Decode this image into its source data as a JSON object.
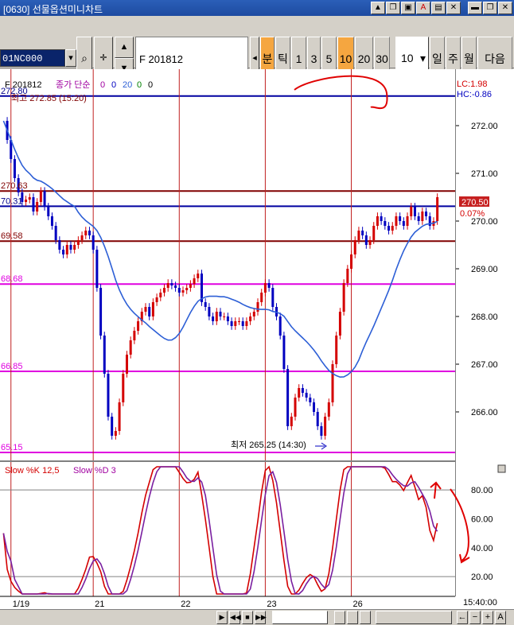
{
  "window": {
    "title": "[0630] 선물옵션미니차트",
    "buttons": [
      "▲",
      "❐",
      "▣",
      "A",
      "▤",
      "✕"
    ],
    "tail_buttons": [
      "▬",
      "❐",
      "✕"
    ]
  },
  "toolbar": {
    "code_value": "01NC000",
    "name_value": "F 201812",
    "periods": [
      "분",
      "틱",
      "1",
      "3",
      "5",
      "10",
      "20",
      "30"
    ],
    "active_period": "10",
    "count_value": "10",
    "units": [
      "일",
      "주",
      "월"
    ],
    "next_label": "다음"
  },
  "legend": {
    "instrument": "F 201812",
    "indicator": "종가 단순",
    "params": [
      "0",
      "0",
      "20",
      "0",
      "0"
    ],
    "high_text": "최고 272.85 (15:20)",
    "low_text": "최저 265.25 (14:30)",
    "lc": "LC:1.98",
    "hc": "HC:-0.86",
    "current_price": "270.50",
    "change_pct": "0.07%"
  },
  "price_axis": {
    "ticks": [
      "272.00",
      "271.00",
      "270.00",
      "269.00",
      "268.00",
      "267.00",
      "266.00"
    ],
    "tick_values": [
      272,
      271,
      270,
      269,
      268,
      267,
      266
    ],
    "range": [
      265.05,
      272.85
    ]
  },
  "level_labels": [
    {
      "text": "272.80",
      "value": 272.62,
      "color": "#00008b"
    },
    {
      "text": "270.63",
      "value": 270.63,
      "color": "#800000"
    },
    {
      "text": "70.31",
      "value": 270.31,
      "color": "#00008b"
    },
    {
      "text": "69.58",
      "value": 269.58,
      "color": "#800000"
    },
    {
      "text": "68.68",
      "value": 268.68,
      "color": "#e000e0"
    },
    {
      "text": "66.85",
      "value": 266.85,
      "color": "#e000e0"
    },
    {
      "text": "65.15",
      "value": 265.15,
      "color": "#e000e0"
    }
  ],
  "stoch": {
    "title": "Slow %K 12,5",
    "title2": "Slow %D 3",
    "ticks": [
      "80.00",
      "60.00",
      "40.00",
      "20.00"
    ],
    "tick_values": [
      80,
      60,
      40,
      20
    ]
  },
  "time_axis": {
    "labels": [
      "1/19",
      "21",
      "22",
      "23",
      "26"
    ],
    "clock": "15:40:00"
  },
  "colors": {
    "up": "#d40000",
    "down": "#0000c0",
    "ma": "#2d5fd6",
    "day_sep": "#c02020",
    "active": "#f5a640"
  },
  "chart_data": {
    "type": "candlestick",
    "title": "F 201812",
    "xlabel": "",
    "ylabel": "",
    "ylim": [
      265.05,
      272.85
    ],
    "days": [
      "1/19",
      "21",
      "22",
      "23",
      "26"
    ],
    "closes": [
      272.1,
      271.7,
      271.3,
      270.9,
      270.6,
      270.4,
      270.45,
      270.5,
      270.2,
      270.4,
      270.63,
      270.3,
      270.1,
      269.9,
      269.6,
      269.4,
      269.3,
      269.5,
      269.4,
      269.5,
      269.6,
      269.7,
      269.8,
      269.7,
      269.4,
      268.6,
      267.6,
      266.8,
      265.9,
      265.5,
      265.6,
      266.2,
      266.8,
      267.2,
      267.5,
      267.7,
      267.9,
      268.1,
      268.2,
      268.0,
      268.3,
      268.4,
      268.5,
      268.6,
      268.7,
      268.65,
      268.6,
      268.5,
      268.55,
      268.6,
      268.68,
      268.8,
      268.9,
      268.3,
      268.2,
      268.0,
      267.9,
      268.1,
      268.0,
      268.0,
      267.9,
      267.8,
      267.9,
      267.9,
      267.8,
      267.9,
      268.0,
      268.1,
      268.3,
      268.5,
      268.7,
      268.6,
      268.2,
      268.0,
      267.6,
      266.9,
      265.7,
      265.9,
      266.3,
      266.5,
      266.4,
      266.3,
      266.2,
      266.0,
      265.7,
      265.5,
      265.9,
      266.2,
      267.0,
      267.6,
      268.1,
      268.7,
      269.0,
      269.3,
      269.6,
      269.8,
      269.7,
      269.5,
      269.6,
      269.9,
      270.1,
      270.0,
      269.9,
      269.8,
      269.9,
      270.1,
      270.0,
      269.9,
      270.1,
      270.3,
      270.1,
      270.0,
      270.2,
      270.1,
      269.9,
      270.0,
      270.5
    ],
    "ma_window": 20,
    "levels": [
      272.62,
      270.63,
      270.31,
      269.58,
      268.68,
      266.85,
      265.15
    ]
  }
}
